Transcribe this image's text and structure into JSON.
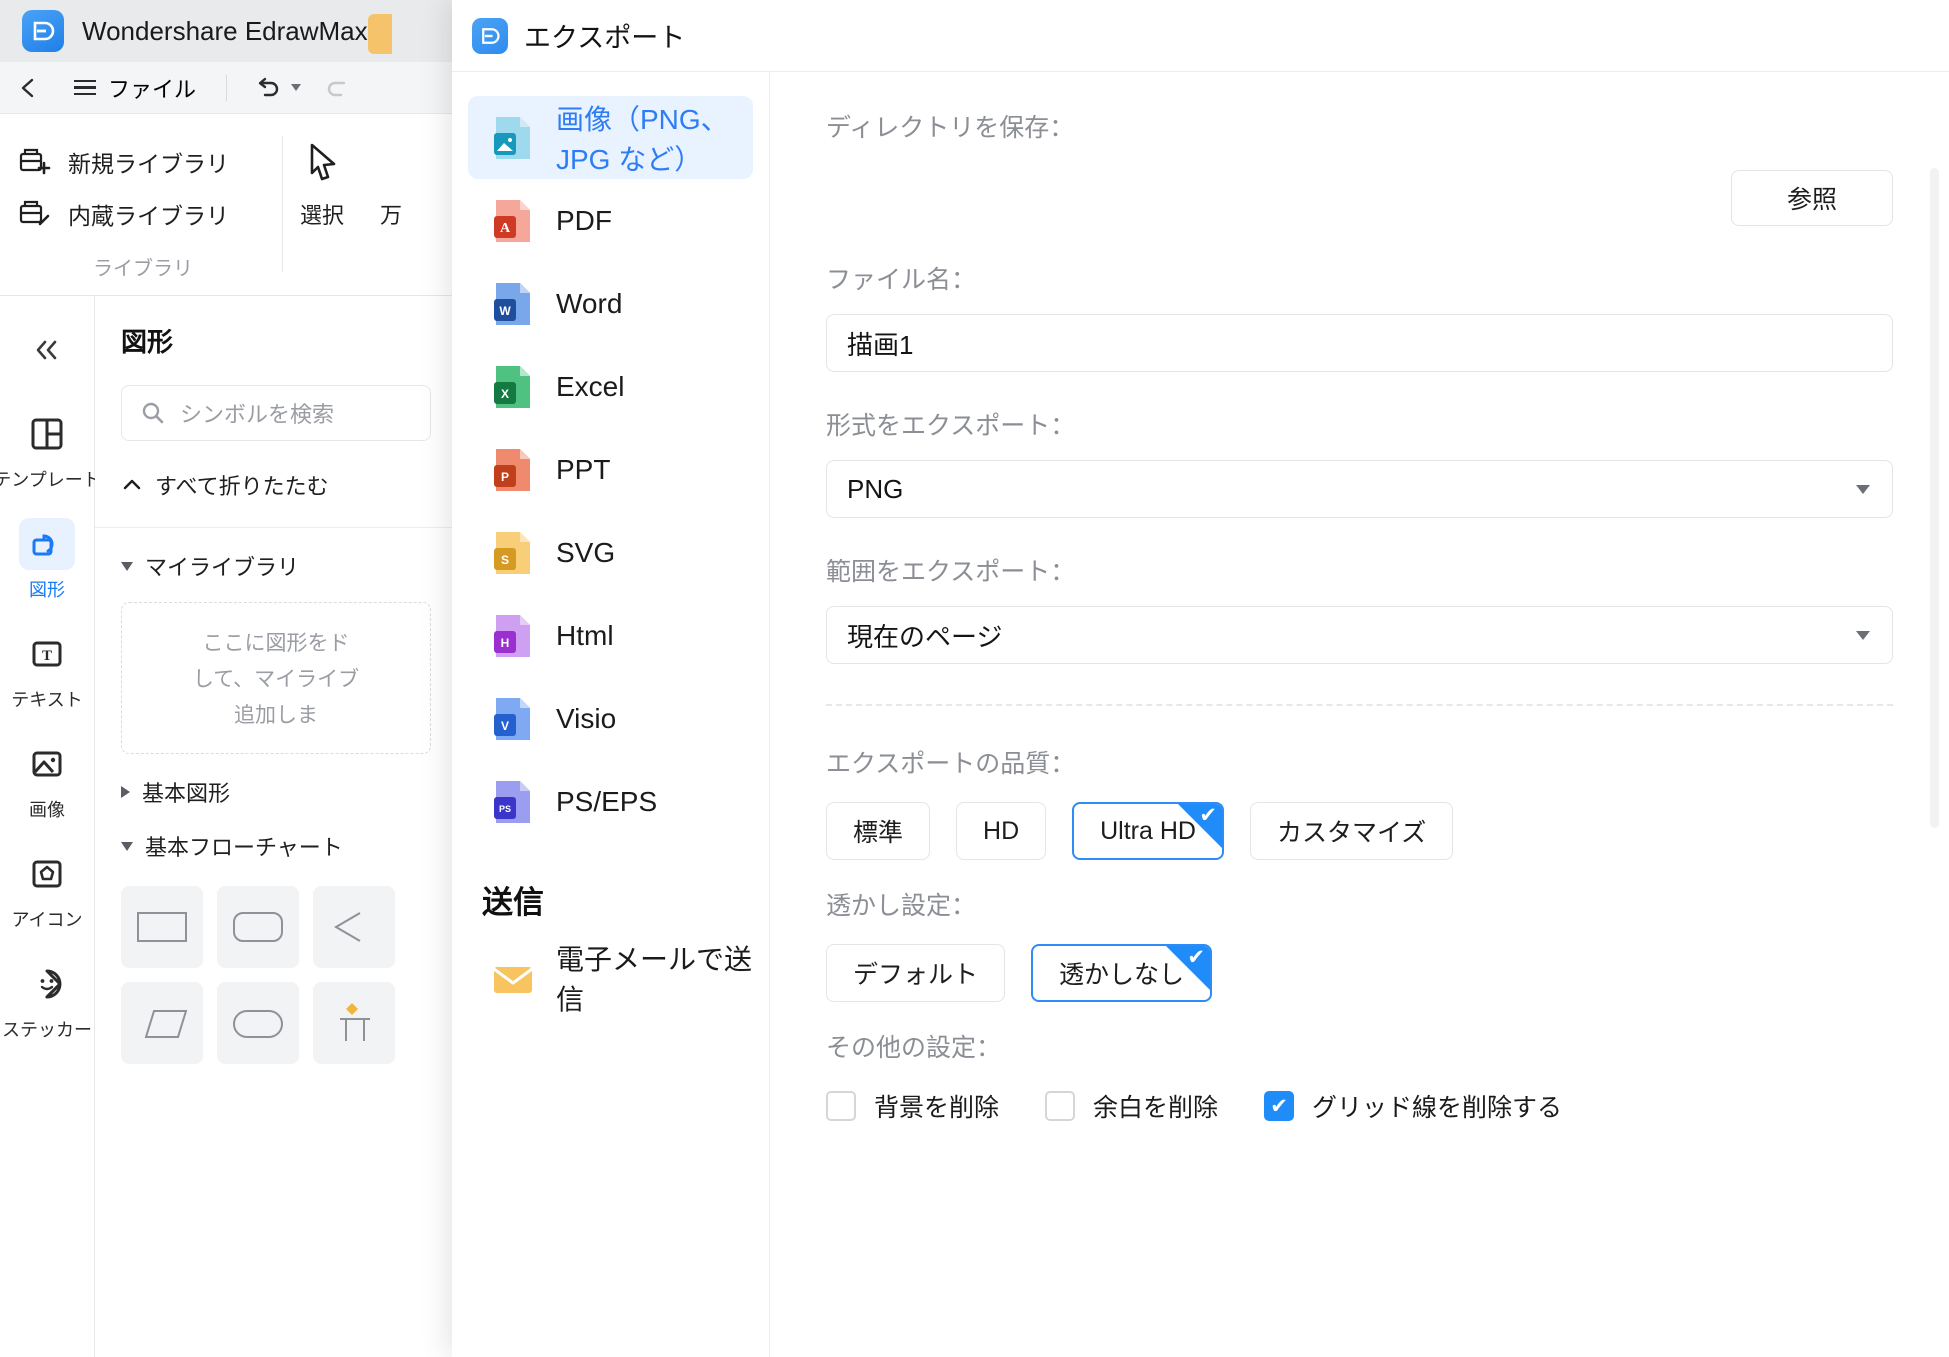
{
  "app": {
    "title": "Wondershare EdrawMax",
    "logo_icon": "edraw-logo-icon",
    "toolbar": {
      "back_icon": "chevron-left-icon",
      "menu_icon": "hamburger-icon",
      "file_label": "ファイル",
      "undo_icon": "undo-icon",
      "undo_caret_icon": "chevron-down-icon",
      "redo_icon": "redo-icon"
    },
    "ribbon": {
      "library_items": [
        {
          "label": "新規ライブラリ",
          "icon": "library-add-icon"
        },
        {
          "label": "内蔵ライブラリ",
          "icon": "library-edit-icon"
        }
      ],
      "library_caption": "ライブラリ",
      "tools": [
        {
          "label": "選択",
          "icon": "cursor-arrow-icon"
        },
        {
          "label": "万",
          "icon": "tool-icon"
        }
      ]
    },
    "rail": {
      "collapse_icon": "double-chevron-left-icon",
      "items": [
        {
          "label": "テンプレート",
          "icon": "template-icon",
          "active": false
        },
        {
          "label": "図形",
          "icon": "shapes-icon",
          "active": true
        },
        {
          "label": "テキスト",
          "icon": "text-icon",
          "active": false
        },
        {
          "label": "画像",
          "icon": "image-icon",
          "active": false
        },
        {
          "label": "アイコン",
          "icon": "icon-icon",
          "active": false
        },
        {
          "label": "ステッカー",
          "icon": "sticker-icon",
          "active": false
        }
      ]
    },
    "shapes_panel": {
      "title": "図形",
      "search_placeholder": "シンボルを検索",
      "search_icon": "search-icon",
      "collapse_all_label": "すべて折りたたむ",
      "collapse_all_icon": "chevron-up-icon",
      "my_library_label": "マイライブラリ",
      "drop_hint_lines": [
        "ここに図形をド",
        "して、マイライブ",
        "追加しま"
      ],
      "groups": [
        {
          "label": "基本図形",
          "expanded": false
        },
        {
          "label": "基本フローチャート",
          "expanded": true
        }
      ]
    }
  },
  "dialog": {
    "title": "エクスポート",
    "logo_icon": "edraw-logo-icon",
    "formats": [
      {
        "label": "画像（PNG、JPG など）",
        "icon": "image-file-icon",
        "active": true
      },
      {
        "label": "PDF",
        "icon": "pdf-file-icon",
        "active": false
      },
      {
        "label": "Word",
        "icon": "word-file-icon",
        "active": false
      },
      {
        "label": "Excel",
        "icon": "excel-file-icon",
        "active": false
      },
      {
        "label": "PPT",
        "icon": "ppt-file-icon",
        "active": false
      },
      {
        "label": "SVG",
        "icon": "svg-file-icon",
        "active": false
      },
      {
        "label": "Html",
        "icon": "html-file-icon",
        "active": false
      },
      {
        "label": "Visio",
        "icon": "visio-file-icon",
        "active": false
      },
      {
        "label": "PS/EPS",
        "icon": "pseps-file-icon",
        "active": false
      }
    ],
    "send_section_title": "送信",
    "send_items": [
      {
        "label": "電子メールで送信",
        "icon": "email-icon"
      }
    ],
    "fields": {
      "save_directory_label": "ディレクトリを保存：",
      "browse_button": "参照",
      "file_name_label": "ファイル名：",
      "file_name_value": "描画1",
      "export_format_label": "形式をエクスポート：",
      "export_format_value": "PNG",
      "export_range_label": "範囲をエクスポート：",
      "export_range_value": "現在のページ",
      "quality_label": "エクスポートの品質：",
      "quality_options": [
        {
          "label": "標準",
          "selected": false
        },
        {
          "label": "HD",
          "selected": false
        },
        {
          "label": "Ultra HD",
          "selected": true
        },
        {
          "label": "カスタマイズ",
          "selected": false
        }
      ],
      "watermark_label": "透かし設定：",
      "watermark_options": [
        {
          "label": "デフォルト",
          "selected": false
        },
        {
          "label": "透かしなし",
          "selected": true
        }
      ],
      "other_label": "その他の設定：",
      "other_options": [
        {
          "label": "背景を削除",
          "checked": false
        },
        {
          "label": "余白を削除",
          "checked": false
        },
        {
          "label": "グリッド線を削除する",
          "checked": true
        }
      ]
    }
  },
  "colors": {
    "accent": "#1f8cf9",
    "accent_soft": "#e8f3ff",
    "text": "#1b1b1b",
    "muted": "#8b8e94",
    "border": "#e4e5e8"
  }
}
